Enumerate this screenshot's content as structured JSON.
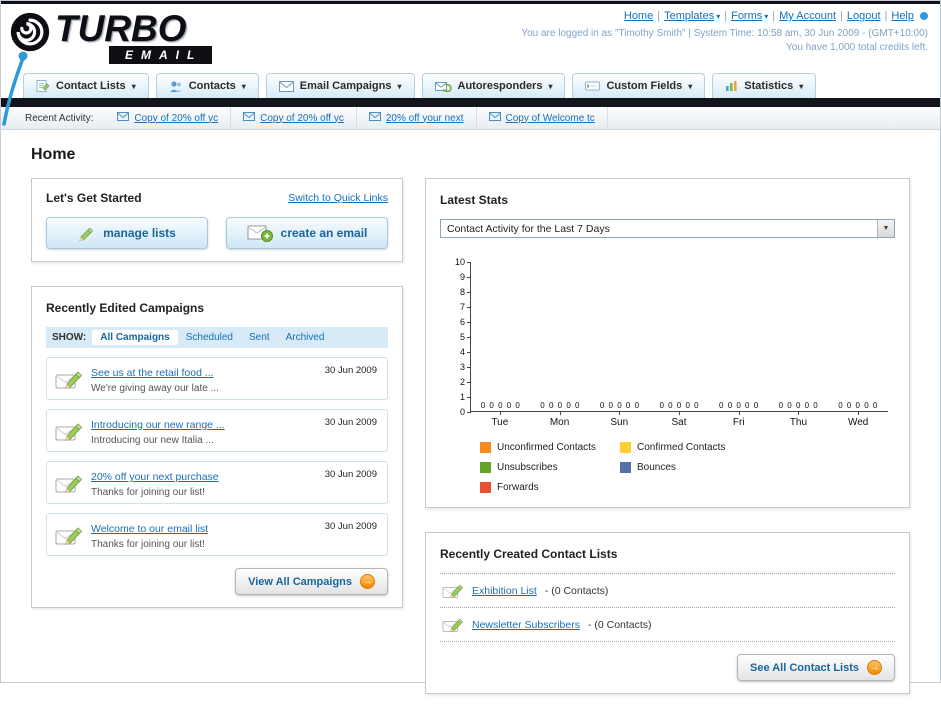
{
  "header": {
    "logo_primary": "TURBO",
    "logo_secondary": "EMAIL",
    "nav_links": [
      {
        "label": "Home",
        "dropdown": false
      },
      {
        "label": "Templates",
        "dropdown": true
      },
      {
        "label": "Forms",
        "dropdown": true
      },
      {
        "label": "My Account",
        "dropdown": false
      },
      {
        "label": "Logout",
        "dropdown": false
      },
      {
        "label": "Help",
        "dropdown": false
      }
    ],
    "login_info": "You are logged in as \"Timothy Smith\" | System Time: 10:58 am, 30 Jun 2009 - (GMT+10:00)",
    "credits_info": "You have 1,000 total credits left."
  },
  "main_nav": [
    {
      "label": "Contact Lists",
      "icon": "contact-lists-icon"
    },
    {
      "label": "Contacts",
      "icon": "contacts-icon"
    },
    {
      "label": "Email Campaigns",
      "icon": "email-campaigns-icon"
    },
    {
      "label": "Autoresponders",
      "icon": "autoresponders-icon"
    },
    {
      "label": "Custom Fields",
      "icon": "custom-fields-icon"
    },
    {
      "label": "Statistics",
      "icon": "statistics-icon"
    }
  ],
  "recent_activity": {
    "label": "Recent Activity:",
    "items": [
      "Copy of 20% off yc",
      "Copy of 20% off yc",
      "20% off your next",
      "Copy of Welcome tc"
    ]
  },
  "page_title": "Home",
  "get_started": {
    "title": "Let's Get Started",
    "switch_link": "Switch to Quick Links",
    "buttons": [
      {
        "label": "manage lists",
        "icon": "pencil-icon"
      },
      {
        "label": "create an email",
        "icon": "envelope-plus-icon"
      }
    ]
  },
  "campaigns": {
    "title": "Recently Edited Campaigns",
    "show_label": "SHOW:",
    "filters": [
      {
        "label": "All Campaigns",
        "selected": true
      },
      {
        "label": "Scheduled",
        "selected": false
      },
      {
        "label": "Sent",
        "selected": false
      },
      {
        "label": "Archived",
        "selected": false
      }
    ],
    "items": [
      {
        "title": "See us at the retail food ...",
        "subtitle": "We're giving away our late ...",
        "date": "30 Jun 2009"
      },
      {
        "title": "Introducing our new range ...",
        "subtitle": "Introducing our new Italia ...",
        "date": "30 Jun 2009"
      },
      {
        "title": "20% off your next purchase",
        "subtitle": "Thanks for joining our list!",
        "date": "30 Jun 2009"
      },
      {
        "title": "Welcome to our email list",
        "subtitle": "Thanks for joining our list!",
        "date": "30 Jun 2009"
      }
    ],
    "view_all_label": "View All Campaigns"
  },
  "stats": {
    "title": "Latest Stats",
    "dropdown_value": "Contact Activity for the Last 7 Days",
    "chart_data": {
      "type": "bar",
      "title": "Contact Activity for the Last 7 Days",
      "categories": [
        "Tue",
        "Mon",
        "Sun",
        "Sat",
        "Fri",
        "Thu",
        "Wed"
      ],
      "series": [
        {
          "name": "Unconfirmed Contacts",
          "color": "#f6891f",
          "values": [
            0,
            0,
            0,
            0,
            0,
            0,
            0
          ]
        },
        {
          "name": "Confirmed Contacts",
          "color": "#fece33",
          "values": [
            0,
            0,
            0,
            0,
            0,
            0,
            0
          ]
        },
        {
          "name": "Unsubscribes",
          "color": "#63a427",
          "values": [
            0,
            0,
            0,
            0,
            0,
            0,
            0
          ]
        },
        {
          "name": "Bounces",
          "color": "#5471a8",
          "values": [
            0,
            0,
            0,
            0,
            0,
            0,
            0
          ]
        },
        {
          "name": "Forwards",
          "color": "#e8512d",
          "values": [
            0,
            0,
            0,
            0,
            0,
            0,
            0
          ]
        }
      ],
      "ylim": [
        0,
        10
      ],
      "yticks": [
        0,
        1,
        2,
        3,
        4,
        5,
        6,
        7,
        8,
        9,
        10
      ],
      "legend_position": "bottom",
      "grid": false
    }
  },
  "contact_lists": {
    "title": "Recently Created Contact Lists",
    "items": [
      {
        "name": "Exhibition List",
        "detail": "- (0 Contacts)"
      },
      {
        "name": "Newsletter Subscribers",
        "detail": "- (0 Contacts)"
      }
    ],
    "see_all_label": "See All Contact Lists"
  }
}
